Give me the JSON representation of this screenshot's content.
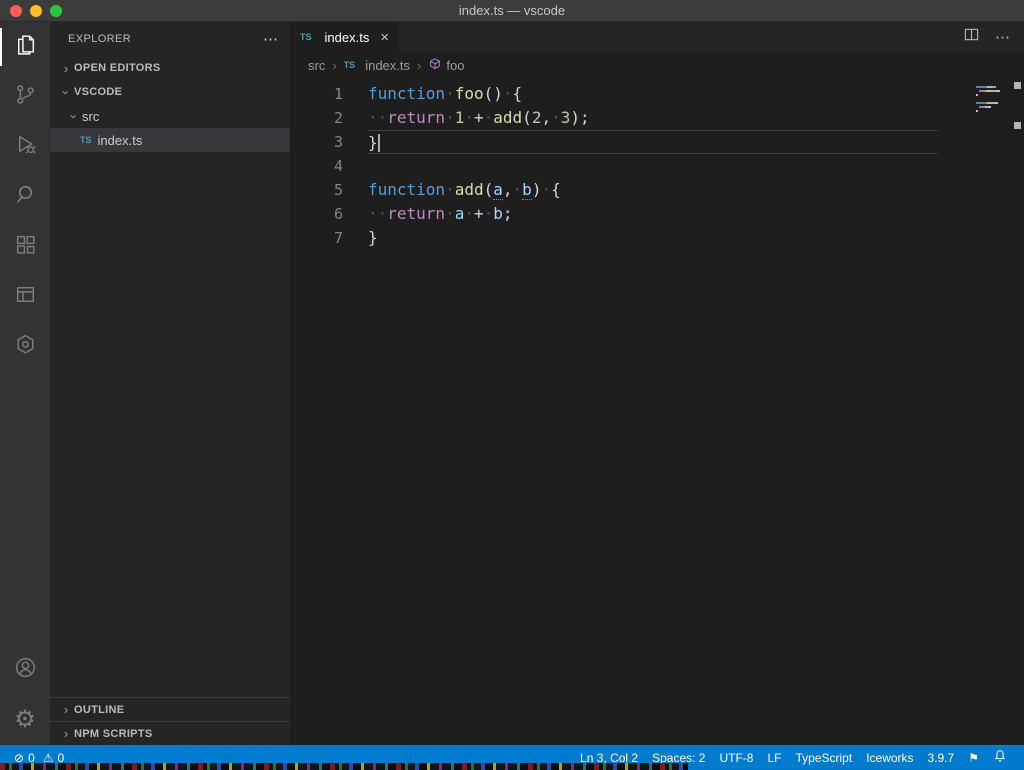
{
  "window": {
    "title": "index.ts — vscode"
  },
  "icons": {
    "ellipsis": "⋯",
    "close": "×",
    "chevron": "›",
    "breadcrumb_sep": "›",
    "gear": "⚙",
    "error": "⊘",
    "warning": "⚠",
    "flag": "⚑",
    "ts_badge": "TS"
  },
  "colors": {
    "status_bar": "#007acc",
    "editor_bg": "#1e1e1e",
    "sidebar_bg": "#252526",
    "activity_bar_bg": "#333333",
    "keyword": "#569cd6",
    "control": "#c586c0",
    "function": "#dcdcaa",
    "number": "#b5cea8",
    "parameter": "#9cdcfe"
  },
  "sidebar": {
    "title": "EXPLORER",
    "open_editors": "OPEN EDITORS",
    "workspace": "VSCODE",
    "folder_src": "src",
    "file_index": "index.ts",
    "outline": "OUTLINE",
    "npm_scripts": "NPM SCRIPTS"
  },
  "editor": {
    "tab": {
      "label": "index.ts"
    },
    "breadcrumbs": {
      "root": "src",
      "file": "index.ts",
      "symbol": "foo"
    },
    "code": {
      "lines": [
        {
          "num": "1",
          "tokens": [
            {
              "c": "kw",
              "t": "function"
            },
            {
              "c": "ws",
              "t": "·"
            },
            {
              "c": "fn",
              "t": "foo"
            },
            {
              "c": "pl",
              "t": "()"
            },
            {
              "c": "ws",
              "t": "·"
            },
            {
              "c": "pl",
              "t": "{"
            }
          ]
        },
        {
          "num": "2",
          "tokens": [
            {
              "c": "ws",
              "t": "··"
            },
            {
              "c": "ctrl",
              "t": "return"
            },
            {
              "c": "ws",
              "t": "·"
            },
            {
              "c": "num",
              "t": "1"
            },
            {
              "c": "ws",
              "t": "·"
            },
            {
              "c": "pl",
              "t": "+"
            },
            {
              "c": "ws",
              "t": "·"
            },
            {
              "c": "fn",
              "t": "add"
            },
            {
              "c": "pl",
              "t": "("
            },
            {
              "c": "num",
              "t": "2"
            },
            {
              "c": "pl",
              "t": ","
            },
            {
              "c": "ws",
              "t": "·"
            },
            {
              "c": "num",
              "t": "3"
            },
            {
              "c": "pl",
              "t": ");"
            }
          ]
        },
        {
          "num": "3",
          "current": true,
          "tokens": [
            {
              "c": "pl",
              "t": "}"
            },
            {
              "c": "cursor",
              "t": ""
            }
          ]
        },
        {
          "num": "4",
          "tokens": []
        },
        {
          "num": "5",
          "tokens": [
            {
              "c": "kw",
              "t": "function"
            },
            {
              "c": "ws",
              "t": "·"
            },
            {
              "c": "fn",
              "t": "add"
            },
            {
              "c": "pl",
              "t": "("
            },
            {
              "c": "param underlined",
              "t": "a"
            },
            {
              "c": "pl",
              "t": ","
            },
            {
              "c": "ws",
              "t": "·"
            },
            {
              "c": "param underlined",
              "t": "b"
            },
            {
              "c": "pl",
              "t": ")"
            },
            {
              "c": "ws",
              "t": "·"
            },
            {
              "c": "pl",
              "t": "{"
            }
          ]
        },
        {
          "num": "6",
          "tokens": [
            {
              "c": "ws",
              "t": "··"
            },
            {
              "c": "ctrl",
              "t": "return"
            },
            {
              "c": "ws",
              "t": "·"
            },
            {
              "c": "param",
              "t": "a"
            },
            {
              "c": "ws",
              "t": "·"
            },
            {
              "c": "pl",
              "t": "+"
            },
            {
              "c": "ws",
              "t": "·"
            },
            {
              "c": "param",
              "t": "b"
            },
            {
              "c": "pl",
              "t": ";"
            }
          ]
        },
        {
          "num": "7",
          "tokens": [
            {
              "c": "pl",
              "t": "}"
            }
          ]
        }
      ]
    }
  },
  "status_bar": {
    "errors": "0",
    "warnings": "0",
    "cursor_position": "Ln 3, Col 2",
    "indentation": "Spaces: 2",
    "encoding": "UTF-8",
    "eol": "LF",
    "language": "TypeScript",
    "extension_name": "Iceworks",
    "extension_version": "3.9.7"
  }
}
